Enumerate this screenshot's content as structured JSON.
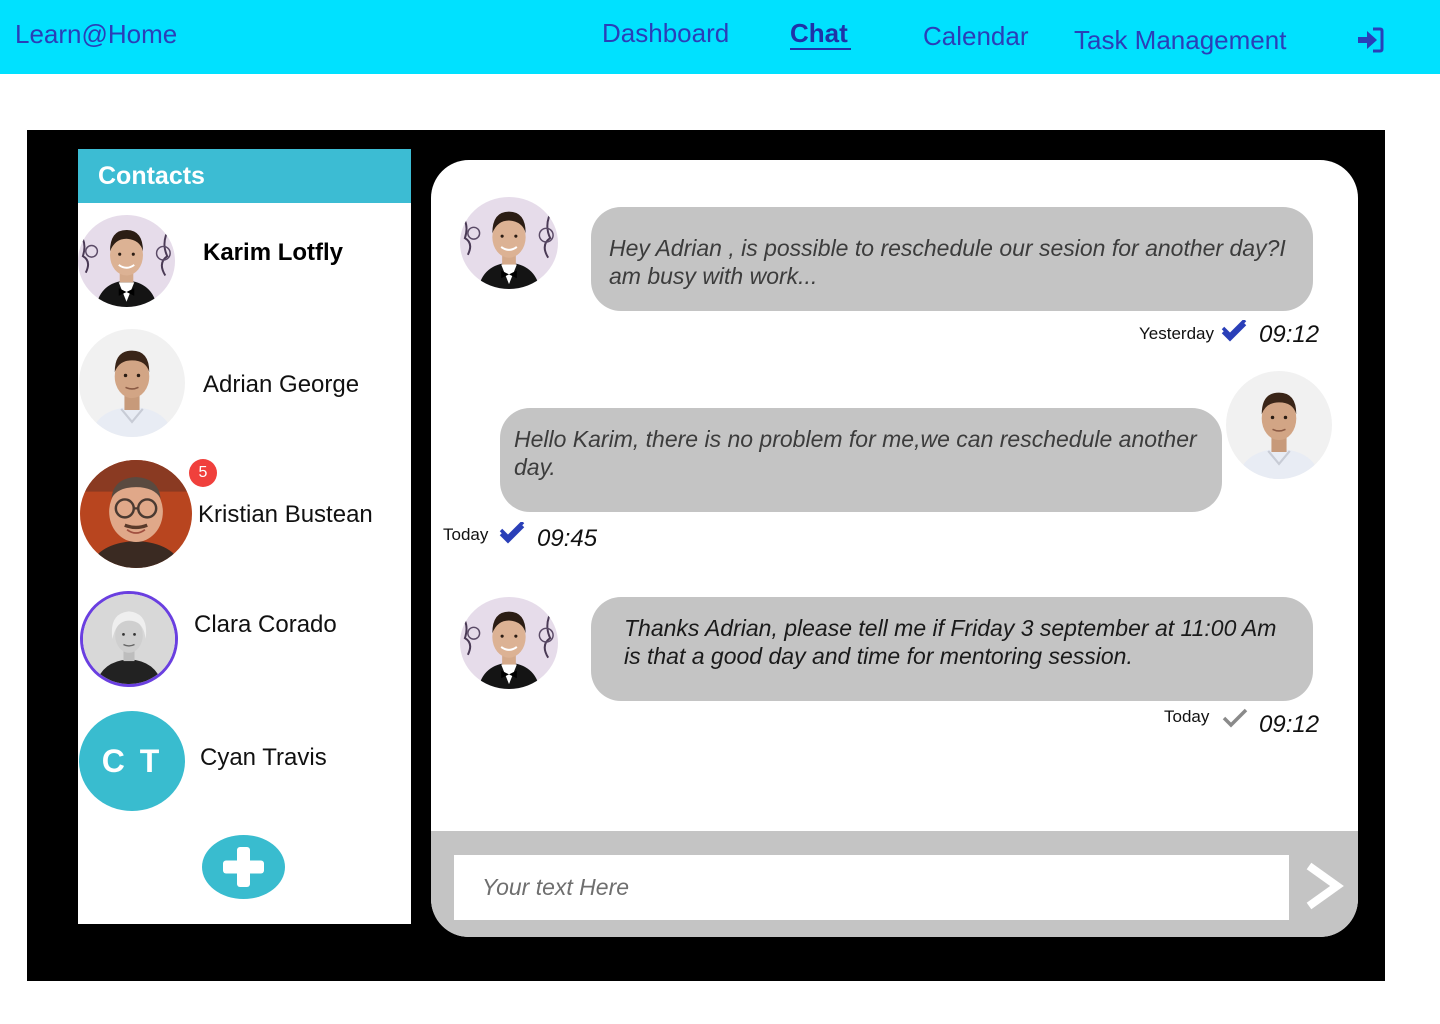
{
  "header": {
    "brand": "Learn@Home",
    "nav": {
      "dashboard": "Dashboard",
      "chat": "Chat",
      "calendar": "Calendar",
      "tasks": "Task Management"
    },
    "logout_icon": "sign-in-icon"
  },
  "contacts": {
    "title": "Contacts",
    "items": [
      {
        "name": "Karim Lotfly",
        "selected": true
      },
      {
        "name": "Adrian George"
      },
      {
        "name": "Kristian Bustean",
        "badge": "5"
      },
      {
        "name": "Clara Corado"
      },
      {
        "name": "Cyan Travis",
        "initials": "C T"
      }
    ],
    "add_icon": "plus-icon"
  },
  "chat": {
    "messages": [
      {
        "from": "Karim Lotfly",
        "text": "Hey Adrian , is possible to reschedule our sesion for another day?I am busy with work...",
        "day": "Yesterday",
        "time": "09:12",
        "status": "read"
      },
      {
        "from": "Adrian George",
        "text": "Hello Karim, there is no problem for me,we can reschedule another day.",
        "day": "Today",
        "time": "09:45",
        "status": "read"
      },
      {
        "from": "Karim Lotfly",
        "text": "Thanks Adrian, please tell me if Friday 3 september at 11:00 Am is that a good day and time for mentoring session.",
        "day": "Today",
        "time": "09:12",
        "status": "sent"
      }
    ],
    "composer": {
      "placeholder": "Your text Here"
    },
    "send_icon": "chevron-right-icon"
  },
  "colors": {
    "topbar": "#00e1ff",
    "nav_text": "#2a3fb8",
    "contacts_header": "#3cbcd3",
    "bubble": "#c4c4c4",
    "read_check": "#2a3fb8",
    "sent_check": "#8a8a8a",
    "badge": "#f0403c"
  }
}
